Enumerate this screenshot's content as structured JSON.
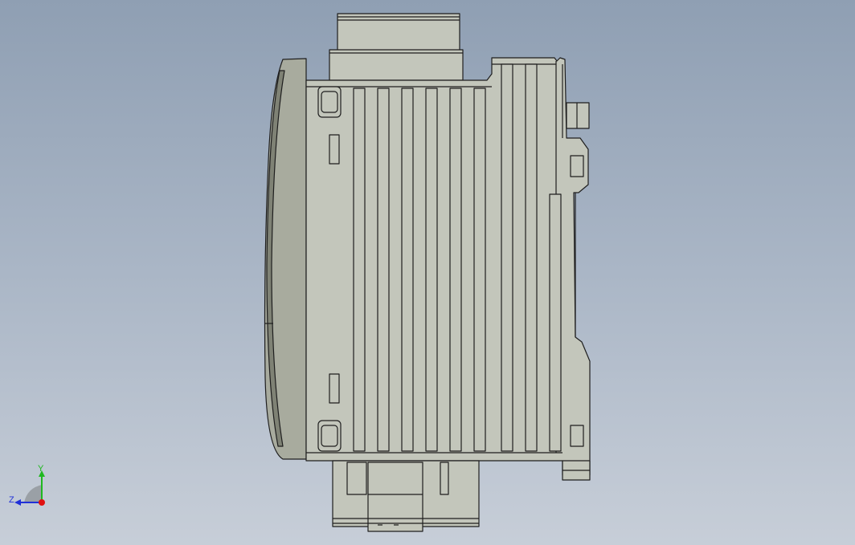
{
  "viewport": {
    "background_top": "#8f9fb3",
    "background_bottom": "#c7ced8"
  },
  "model": {
    "body_fill": "#c3c6bb",
    "edge_color": "#1e1e1e",
    "shadow_fill": "#8e9183"
  },
  "triad": {
    "x_label": "",
    "y_label": "Y",
    "z_label": "Z",
    "x_color": "#e01010",
    "y_color": "#1fb81f",
    "z_color": "#2030d8"
  }
}
